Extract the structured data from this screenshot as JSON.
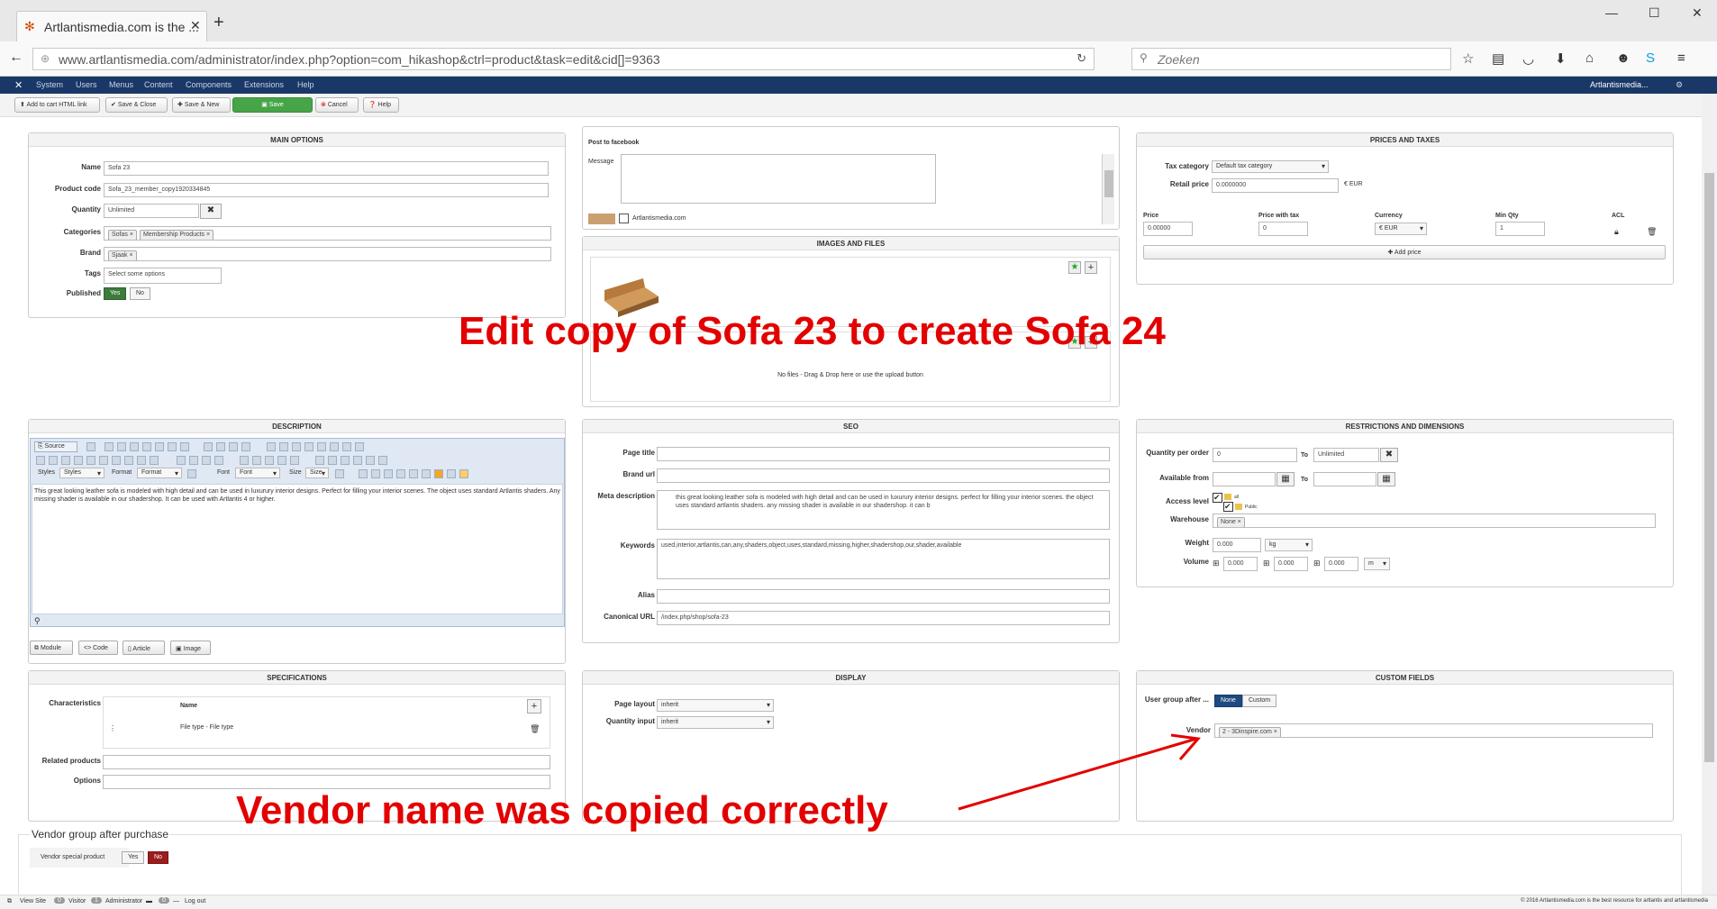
{
  "browser": {
    "tab_title": "Artlantismedia.com is the ...",
    "url": "www.artlantismedia.com/administrator/index.php?option=com_hikashop&ctrl=product&task=edit&cid[]=9363",
    "search_placeholder": "Zoeken"
  },
  "admin": {
    "menu": [
      "System",
      "Users",
      "Menus",
      "Content",
      "Components",
      "Extensions",
      "Help"
    ],
    "site_name": "Artlantismedia..."
  },
  "toolbar": {
    "add_cart": "Add to cart HTML link",
    "save_close": "Save & Close",
    "save_new": "Save & New",
    "save": "Save",
    "cancel": "Cancel",
    "help": "Help"
  },
  "main_options": {
    "title": "MAIN OPTIONS",
    "name_label": "Name",
    "name_value": "Sofa 23",
    "code_label": "Product code",
    "code_value": "Sofa_23_member_copy1920334845",
    "quantity_label": "Quantity",
    "quantity_value": "Unlimited",
    "categories_label": "Categories",
    "categories": [
      "Sofas",
      "Membership Products"
    ],
    "brand_label": "Brand",
    "brand_value": "Sjaak",
    "tags_label": "Tags",
    "tags_placeholder": "Select some options",
    "published_label": "Published",
    "yes": "Yes",
    "no": "No"
  },
  "facebook": {
    "title": "Post to facebook",
    "message_label": "Message",
    "account": "Artlantismedia.com"
  },
  "images": {
    "title": "IMAGES AND FILES",
    "no_files": "No files - Drag & Drop here or use the upload button"
  },
  "prices": {
    "title": "PRICES AND TAXES",
    "tax_label": "Tax category",
    "tax_value": "Default tax category",
    "retail_label": "Retail price",
    "retail_value": "0.0000000",
    "retail_currency": "€ EUR",
    "col_price": "Price",
    "col_price_tax": "Price with tax",
    "col_currency": "Currency",
    "col_min_qty": "Min Qty",
    "col_acl": "ACL",
    "price_value": "0.00000",
    "price_tax_value": "0",
    "currency_value": "€ EUR",
    "min_qty_value": "1",
    "add_price": "Add price"
  },
  "description": {
    "title": "DESCRIPTION",
    "text": "This great looking leather sofa is modeled with high detail and can be used in luxurury interior designs. Perfect for filling your interior scenes. The object uses standard Artlantis shaders. Any missing shader is available in our shadershop. It can be used with Artlantis 4 or higher.",
    "styles_label": "Styles",
    "format_label": "Format",
    "font_label": "Font",
    "size_label": "Size",
    "source_label": "Source",
    "buttons": [
      "Module",
      "Code",
      "Article",
      "Image"
    ]
  },
  "seo": {
    "title": "SEO",
    "page_title_label": "Page title",
    "brand_url_label": "Brand url",
    "meta_label": "Meta description",
    "meta_value": "this great looking leather sofa is modeled with high detail and can be used in luxurury interior designs. perfect for filling your interior scenes. the object uses standard artlantis shaders. any missing shader is available in our shadershop. it can b",
    "keywords_label": "Keywords",
    "keywords_value": "used,interior,artlantis,can,any,shaders,object,uses,standard,missing,higher,shadershop,our,shader,available",
    "alias_label": "Alias",
    "canonical_label": "Canonical URL",
    "canonical_value": "/index.php/shop/sofa-23"
  },
  "restrictions": {
    "title": "RESTRICTIONS AND DIMENSIONS",
    "qty_label": "Quantity per order",
    "qty_min": "0",
    "to": "To",
    "qty_max": "Unlimited",
    "avail_label": "Available from",
    "access_label": "Access level",
    "access_all": "all",
    "access_public": "Public",
    "warehouse_label": "Warehouse",
    "warehouse_value": "None",
    "weight_label": "Weight",
    "weight_value": "0.000",
    "weight_unit": "kg",
    "volume_label": "Volume",
    "volume_values": [
      "0.000",
      "0.000",
      "0.000"
    ],
    "volume_unit": "m"
  },
  "specs": {
    "title": "SPECIFICATIONS",
    "char_label": "Characteristics",
    "name_col": "Name",
    "row_value": "File type - File type",
    "related_label": "Related products",
    "options_label": "Options"
  },
  "display": {
    "title": "DISPLAY",
    "layout_label": "Page layout",
    "layout_value": "inherit",
    "qty_input_label": "Quantity input",
    "qty_input_value": "inherit"
  },
  "custom": {
    "title": "CUSTOM FIELDS",
    "group_label": "User group after ...",
    "none": "None",
    "custom": "Custom",
    "vendor_label": "Vendor",
    "vendor_value": "2 - 3Dinspire.com"
  },
  "vendor_group": {
    "title": "Vendor group after purchase",
    "special_label": "Vendor special product",
    "yes": "Yes",
    "no": "No"
  },
  "annotations": {
    "headline": "Edit copy of Sofa 23 to create Sofa 24",
    "vendor_note": "Vendor name was copied correctly"
  },
  "status": {
    "view_site": "View Site",
    "visitor_count": "0",
    "visitor": "Visitor",
    "admin_count": "1",
    "administrator": "Administrator",
    "msg_count": "0",
    "logout": "Log out",
    "copyright": "© 2016 Artlantismedia.com is the best resource for artlantis and artlantismedia"
  },
  "colors": {
    "admin_bar": "#1a3867",
    "save_green": "#46a546",
    "overlay_red": "#e30000",
    "toggle_active": "#3c7b3c",
    "toggle_no_red": "#9b1c1c"
  }
}
